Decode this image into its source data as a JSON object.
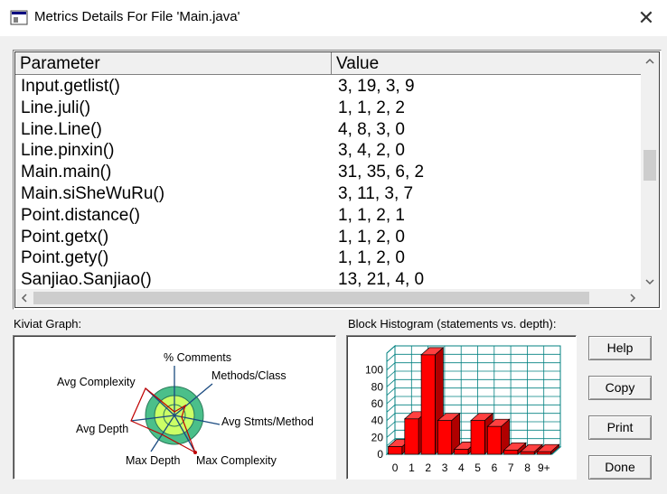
{
  "window": {
    "title": "Metrics Details For File 'Main.java'",
    "close_glyph": "✕"
  },
  "table": {
    "headers": [
      "Parameter",
      "Value"
    ],
    "rows": [
      {
        "param": "Input.getlist()",
        "value": "3, 19, 3, 9"
      },
      {
        "param": "Line.juli()",
        "value": "1, 1, 2, 2"
      },
      {
        "param": "Line.Line()",
        "value": "4, 8, 3, 0"
      },
      {
        "param": "Line.pinxin()",
        "value": "3, 4, 2, 0"
      },
      {
        "param": "Main.main()",
        "value": "31, 35, 6, 2"
      },
      {
        "param": "Main.siSheWuRu()",
        "value": "3, 11, 3, 7"
      },
      {
        "param": "Point.distance()",
        "value": "1, 1, 2, 1"
      },
      {
        "param": "Point.getx()",
        "value": "1, 1, 2, 0"
      },
      {
        "param": "Point.gety()",
        "value": "1, 1, 2, 0"
      },
      {
        "param": "Sanjiao.Sanjiao()",
        "value": "13, 21, 4, 0"
      }
    ],
    "scroll_icons": {
      "up": "chevron-up",
      "down": "chevron-down",
      "left": "chevron-left",
      "right": "chevron-right"
    }
  },
  "kiviat": {
    "label": "Kiviat Graph:",
    "axes": [
      "% Comments",
      "Methods/Class",
      "Avg Stmts/Method",
      "Max Complexity",
      "Max Depth",
      "Avg Depth",
      "Avg Complexity"
    ]
  },
  "histogram": {
    "label": "Block Histogram (statements vs. depth):",
    "bar_color": "#ff0000"
  },
  "buttons": {
    "help": "Help",
    "copy": "Copy",
    "print": "Print",
    "done": "Done"
  },
  "chart_data": [
    {
      "type": "bar",
      "title": "Block Histogram (statements vs. depth):",
      "categories": [
        "0",
        "1",
        "2",
        "3",
        "4",
        "5",
        "6",
        "7",
        "8",
        "9+"
      ],
      "values": [
        9,
        42,
        118,
        40,
        6,
        40,
        33,
        5,
        3,
        3
      ],
      "ylim": [
        0,
        120
      ],
      "yticks": [
        0,
        20,
        40,
        60,
        80,
        100
      ],
      "grid": true,
      "xlabel": "",
      "ylabel": ""
    }
  ]
}
